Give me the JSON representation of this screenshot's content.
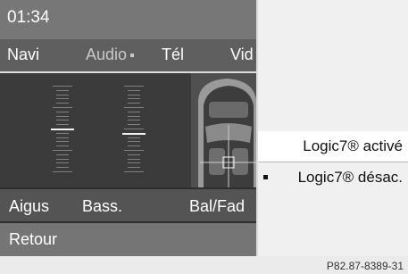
{
  "status": {
    "time": "01:34"
  },
  "menu": {
    "items": [
      {
        "label": "Navi"
      },
      {
        "label": "Audio"
      },
      {
        "label": "Tél"
      },
      {
        "label": "Vid"
      }
    ],
    "active": "Audio"
  },
  "sliders": [
    {
      "name": "Aigus",
      "level_steps_from_bottom": 10
    },
    {
      "name": "Bass.",
      "level_steps_from_bottom": 9
    }
  ],
  "labels": {
    "aigus": "Aigus",
    "bass": "Bass.",
    "balfad": "Bal/Fad"
  },
  "retour": "Retour",
  "options": [
    {
      "label": "Logic7® activé",
      "selected": true
    },
    {
      "label": "Logic7® désac.",
      "selected": false,
      "bullet": true
    }
  ],
  "footer": "P82.87-8389-31"
}
